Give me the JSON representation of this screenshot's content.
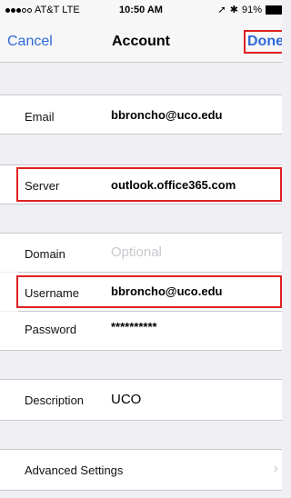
{
  "status_bar": {
    "carrier": "AT&T",
    "network": "LTE",
    "time": "10:50 AM",
    "battery": "91%"
  },
  "nav": {
    "cancel": "Cancel",
    "title": "Account",
    "done": "Done"
  },
  "fields": {
    "email": {
      "label": "Email",
      "value": "bbroncho@uco.edu"
    },
    "server": {
      "label": "Server",
      "value": "outlook.office365.com"
    },
    "domain": {
      "label": "Domain",
      "placeholder": "Optional"
    },
    "username": {
      "label": "Username",
      "value": "bbroncho@uco.edu"
    },
    "password": {
      "label": "Password",
      "value": "**********"
    },
    "description": {
      "label": "Description",
      "value": "UCO"
    },
    "advanced": {
      "label": "Advanced Settings"
    }
  },
  "colors": {
    "accent": "#2f6bd9",
    "highlight": "#e02020",
    "background": "#efeff4"
  }
}
